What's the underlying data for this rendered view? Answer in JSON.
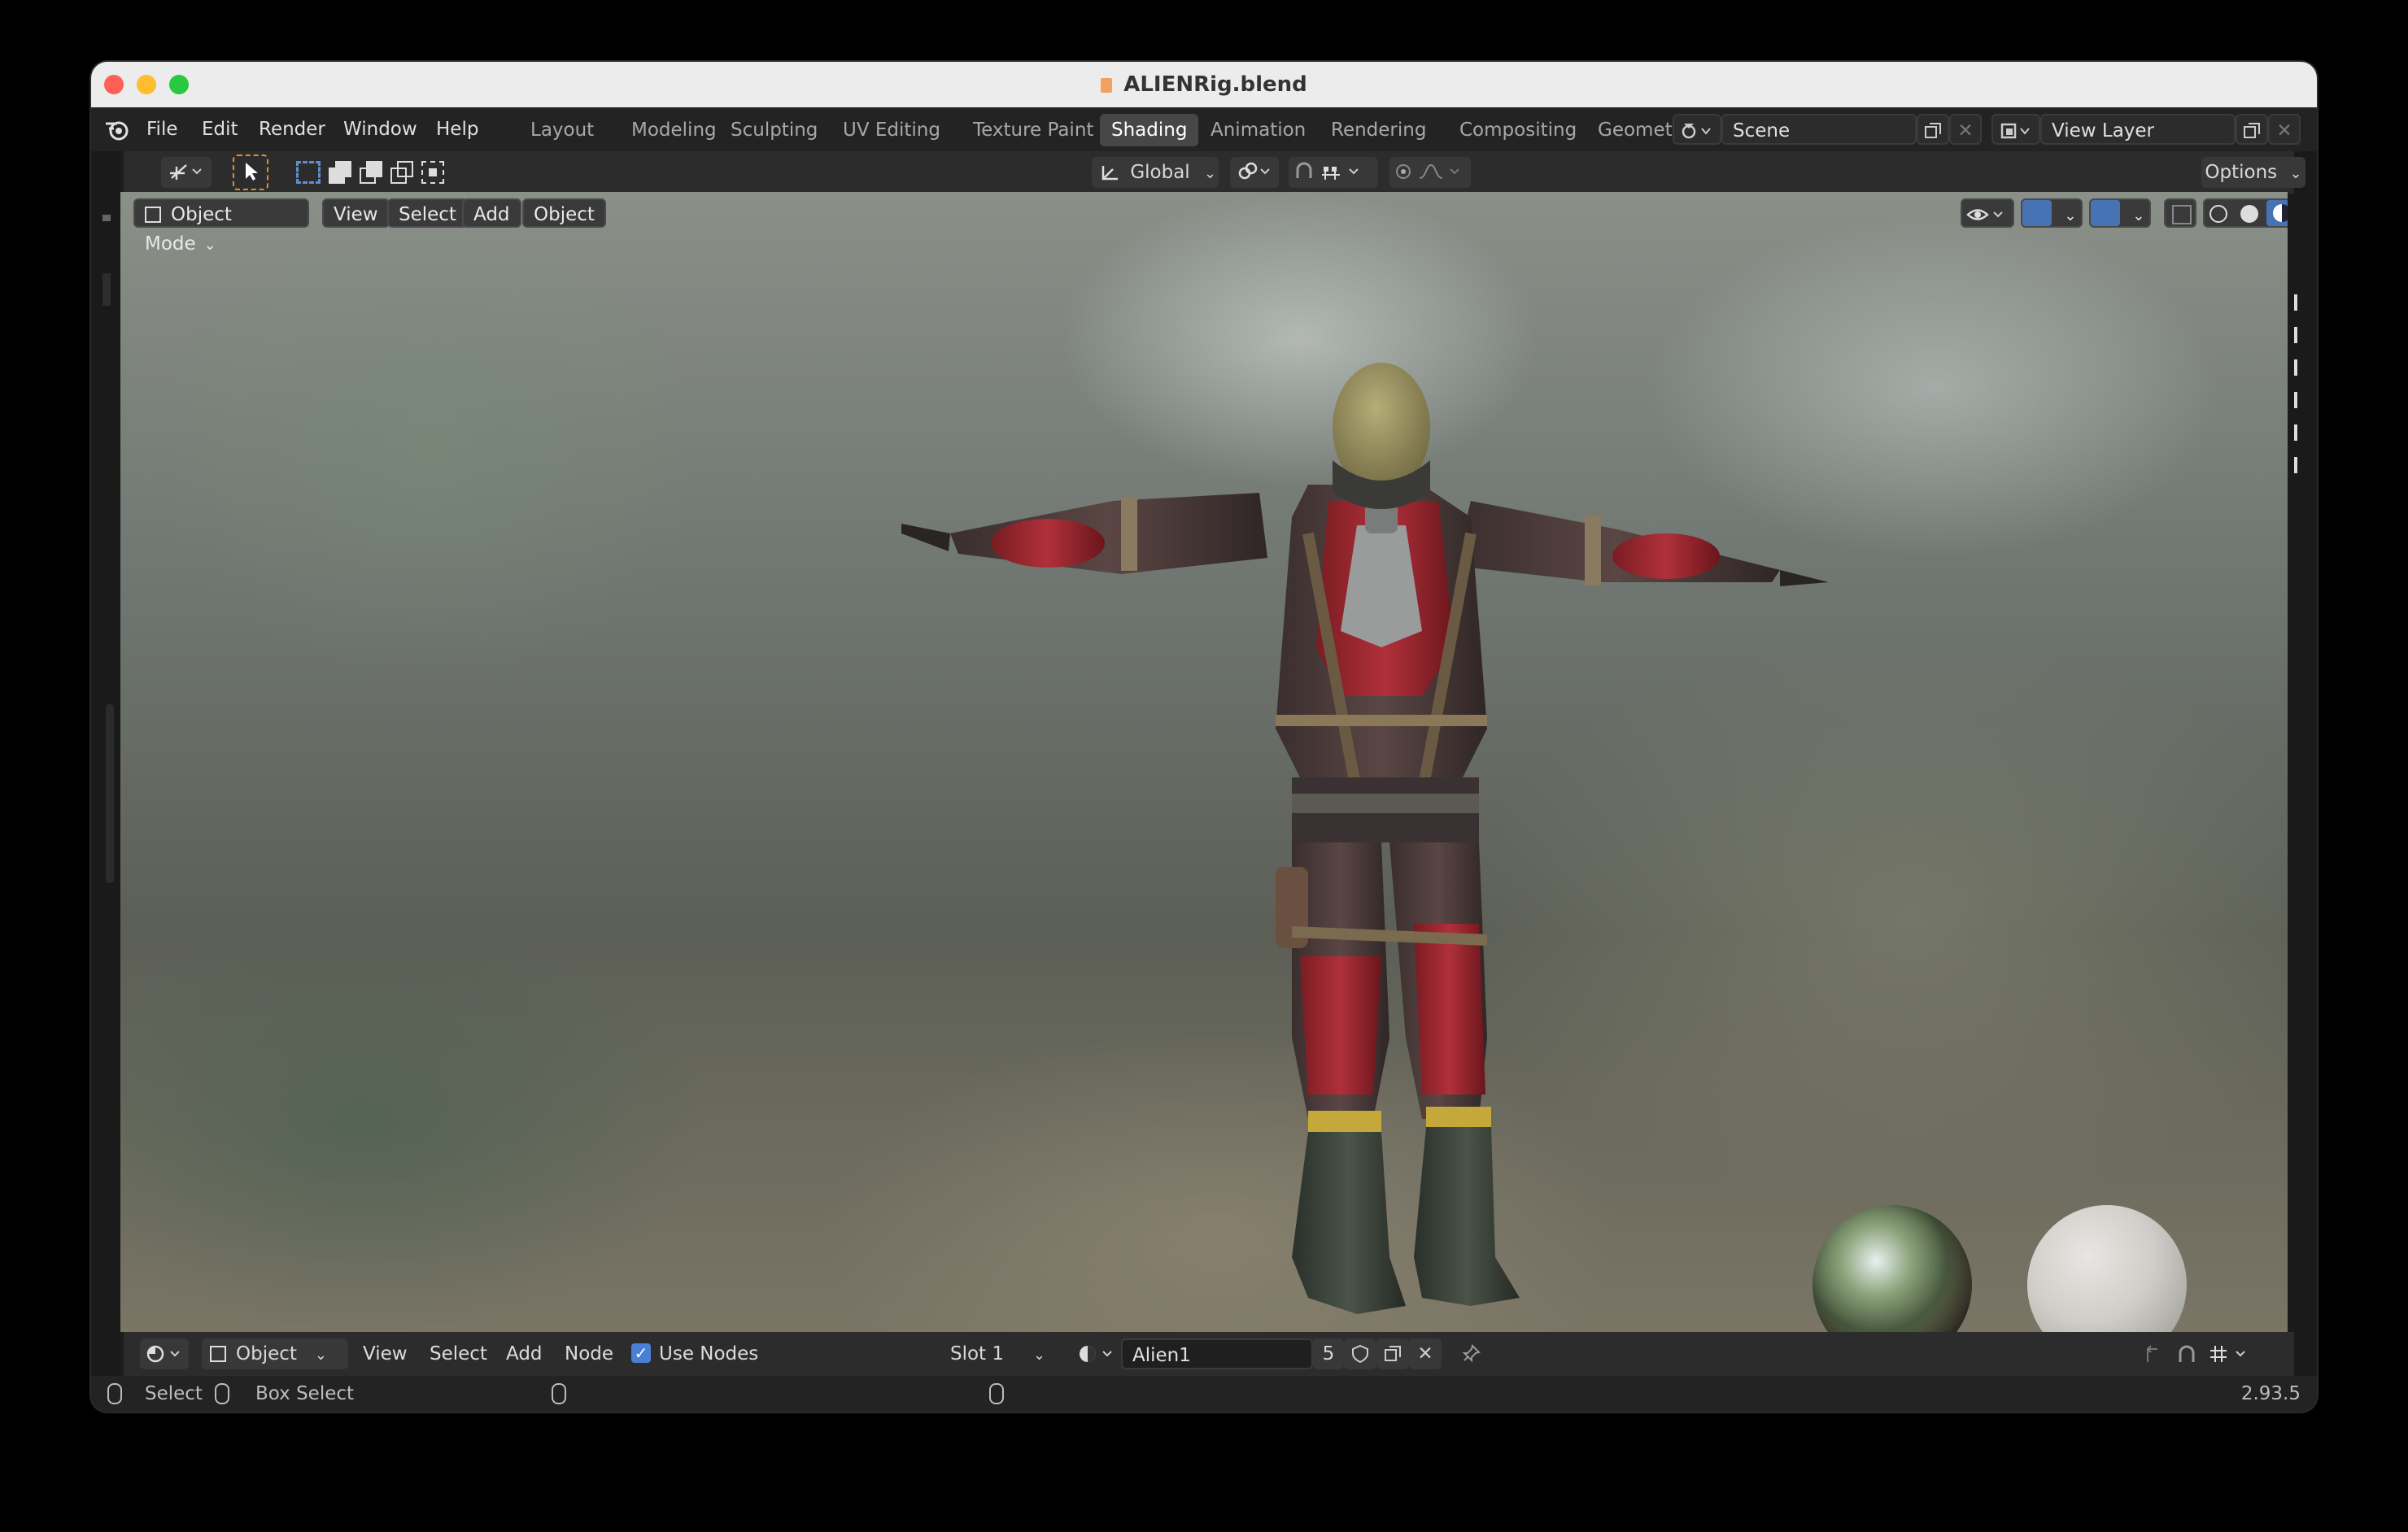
{
  "window": {
    "title": "ALIENRig.blend",
    "traffic_lights": [
      "#ff5f57",
      "#febc2e",
      "#28c840"
    ]
  },
  "menubar": {
    "items": [
      "File",
      "Edit",
      "Render",
      "Window",
      "Help"
    ],
    "workspaces": [
      "Layout",
      "Modeling",
      "Sculpting",
      "UV Editing",
      "Texture Paint",
      "Shading",
      "Animation",
      "Rendering",
      "Compositing",
      "Geomet"
    ],
    "active_workspace": "Shading",
    "scene_name": "Scene",
    "view_layer_name": "View Layer"
  },
  "tool_header": {
    "transform_orientation": "Global",
    "options_label": "Options"
  },
  "viewport_header": {
    "mode": "Object Mode",
    "menus": [
      "View",
      "Select",
      "Add",
      "Object"
    ]
  },
  "viewport": {
    "hdri_preview": "hdri-sphere",
    "material_preview": "white-sphere"
  },
  "node_header": {
    "type": "Object",
    "menus": [
      "View",
      "Select",
      "Add",
      "Node"
    ],
    "use_nodes_label": "Use Nodes",
    "use_nodes_checked": true,
    "slot": "Slot 1",
    "material_name": "Alien1",
    "user_count": "5"
  },
  "statusbar": {
    "select_label": "Select",
    "box_select_label": "Box Select",
    "version": "2.93.5"
  },
  "colors": {
    "accent_blue": "#4772b3",
    "active_tool_orange": "#e0902a",
    "checkbox_blue": "#4a7fd6"
  }
}
